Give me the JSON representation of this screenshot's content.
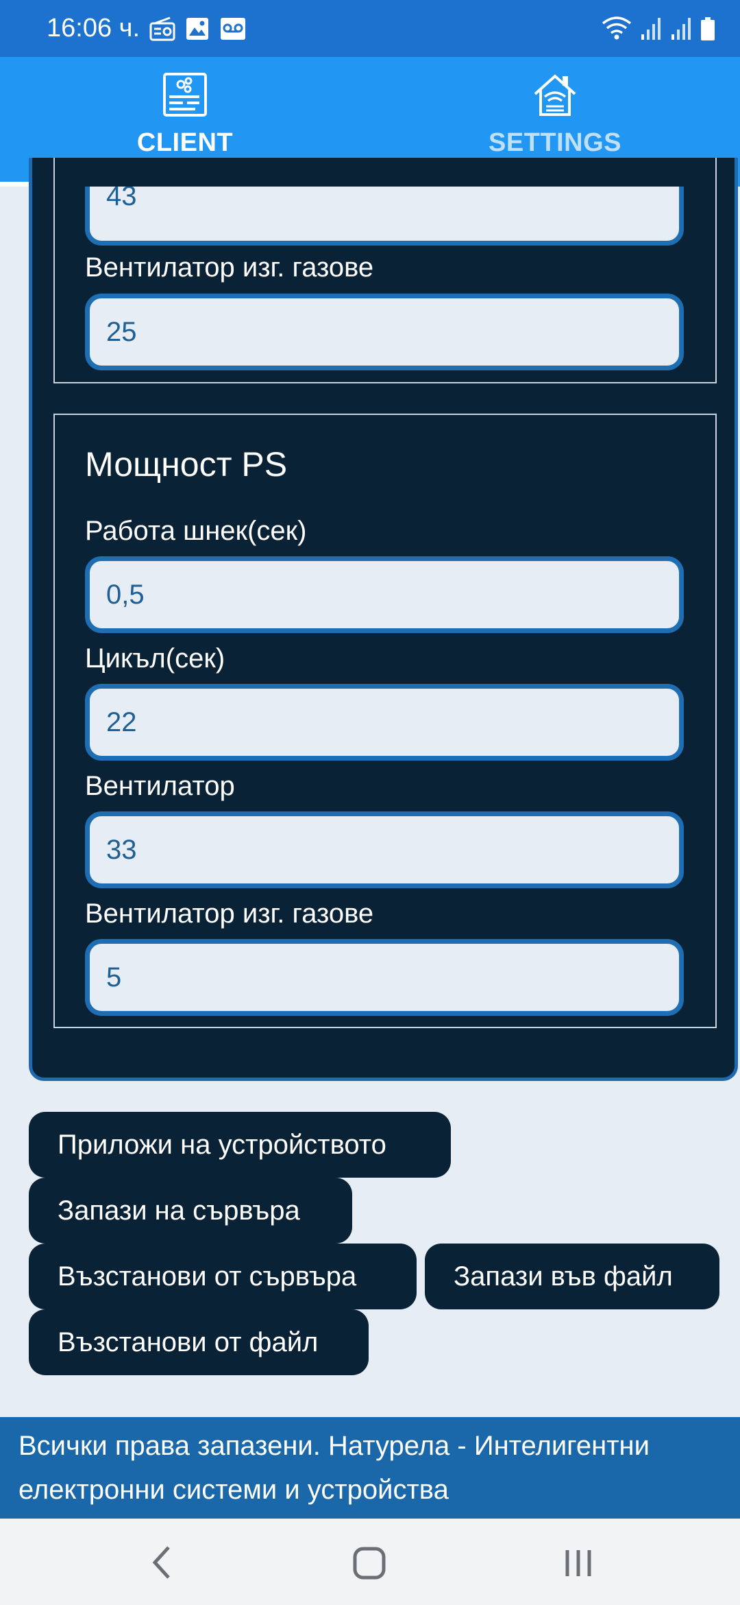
{
  "status_bar": {
    "time": "16:06 ч.",
    "left_icons": [
      "radio-icon",
      "image-icon",
      "voicemail-icon"
    ],
    "right_icons": [
      "wifi-icon",
      "signal-icon",
      "signal-icon",
      "battery-icon"
    ]
  },
  "tabs": [
    {
      "label": "CLIENT",
      "icon": "control-panel-icon",
      "active": true
    },
    {
      "label": "SETTINGS",
      "icon": "smart-home-wifi-icon",
      "active": false
    }
  ],
  "group_a": {
    "fields": [
      {
        "label": "",
        "value": "43"
      },
      {
        "label": "Вентилатор изг. газове",
        "value": "25"
      }
    ]
  },
  "group_b": {
    "title": "Мощност PS",
    "fields": [
      {
        "label": "Работа шнек(сек)",
        "value": "0,5"
      },
      {
        "label": "Цикъл(сек)",
        "value": "22"
      },
      {
        "label": "Вентилатор",
        "value": "33"
      },
      {
        "label": "Вентилатор изг. газове",
        "value": "5"
      }
    ]
  },
  "buttons": {
    "apply": "Приложи на устройството",
    "save_server": "Запази на сървъра",
    "restore_server": "Възстанови от сървъра",
    "save_file": "Запази във файл",
    "restore_file": "Възстанови от файл"
  },
  "footer": {
    "text": "Всички права запазени. Натурела - Интелигентни електронни системи и устройства"
  },
  "colors": {
    "tab_bar": "#2196f3",
    "status_bar": "#1e72cf",
    "panel": "#0a2235",
    "field_border": "#1f6db3",
    "footer": "#1a68aa"
  }
}
